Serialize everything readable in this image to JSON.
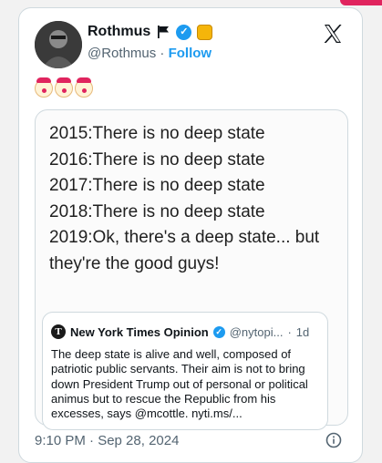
{
  "tweet": {
    "author": {
      "display_name": "Rothmus",
      "handle": "@Rothmus",
      "separator": "·",
      "follow_label": "Follow",
      "badges": [
        "flag-icon",
        "verified-icon",
        "org-badge-icon"
      ]
    },
    "emoji_count": 3,
    "emoji_icon": "clown-face-emoji",
    "image_lines": [
      "2015:There is no deep state",
      "2016:There is no deep state",
      "2017:There is no deep state",
      "2018:There is no deep state",
      "2019:Ok, there's a deep state... but they're the good guys!"
    ],
    "quote": {
      "logo_letter": "T",
      "name": "New York Times Opinion",
      "handle": "@nytopi...",
      "separator": "·",
      "age": "1d",
      "body": "The deep state is alive and well, composed of patriotic public servants. Their aim is not to bring down President Trump out of personal or political animus but to rescue the Republic from his excesses, says @mcottle.  nyti.ms/..."
    },
    "timestamp": "9:10 PM · Sep 28, 2024"
  },
  "colors": {
    "accent": "#1d9bf0",
    "text": "#0f1419",
    "muted": "#536471",
    "border": "#cfd9de",
    "corner": "#e0245e"
  }
}
